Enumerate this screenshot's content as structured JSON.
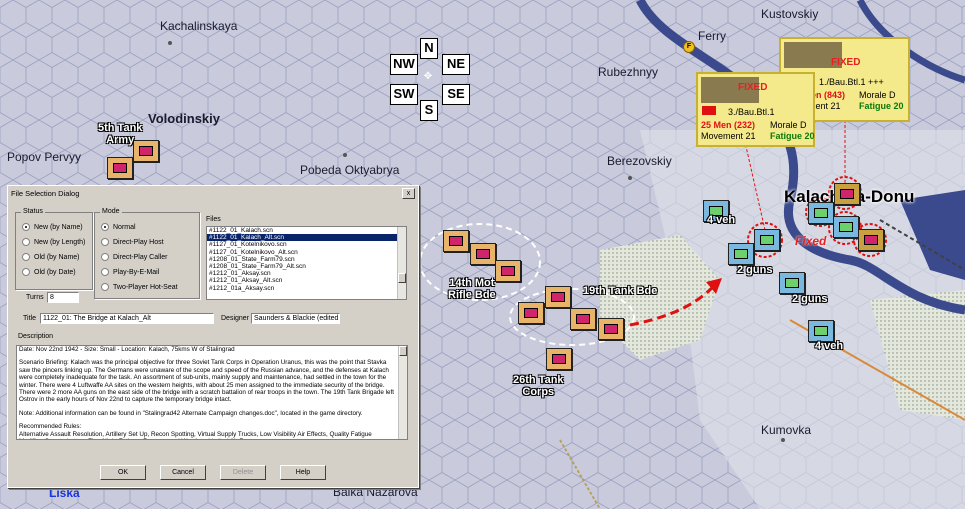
{
  "map": {
    "places": {
      "kachalinskaya": "Kachalinskaya",
      "volodinskiy": "Volodinskiy",
      "popov_pervyy": "Popov Pervyy",
      "pobeda_oktyabrya": "Pobeda Oktyabrya",
      "ferry": "Ferry",
      "kustovskiy": "Kustovskiy",
      "rubezhnyy": "Rubezhnyy",
      "berezovskiy": "Berezovskiy",
      "kalach": "Kalach-na-Donu",
      "kumovka": "Kumovka",
      "liska": "Liska",
      "balka_nazarova": "Balka Nazarova"
    },
    "unit_labels": {
      "army_5th_tank": "5th Tank\nArmy",
      "bde_14th_mot": "14th Mot\nRifle Bde",
      "bde_19th_tank": "19th Tank Bde",
      "corps_26th_tank": "26th Tank\nCorps",
      "veh_4_top": "4 veh",
      "guns_2_a": "2 guns",
      "guns_2_b": "2 guns",
      "veh_4_bottom": "4 veh",
      "fixed": "Fixed"
    },
    "compass": {
      "n": "N",
      "ne": "NE",
      "nw": "NW",
      "se": "SE",
      "sw": "SW",
      "s": "S"
    },
    "ferry_marker": "F",
    "info_card_1": {
      "fixed": "FIXED",
      "unit": "1./Bau.Btl.1 +++",
      "men": "201 Men (843)",
      "morale": "Morale D",
      "movement": "Movement 21",
      "fatigue": "Fatigue 20"
    },
    "info_card_2": {
      "fixed": "FIXED",
      "unit": "3./Bau.Btl.1",
      "men": "25 Men (232)",
      "morale": "Morale D",
      "movement": "Movement 21",
      "fatigue": "Fatigue 20"
    }
  },
  "dialog": {
    "title": "File Selection Dialog",
    "close": "x",
    "status": {
      "label": "Status",
      "options": [
        "New (by Name)",
        "New (by Length)",
        "Old (by Name)",
        "Old (by Date)"
      ],
      "selected": 0
    },
    "mode": {
      "label": "Mode",
      "options": [
        "Normal",
        "Direct-Play Host",
        "Direct-Play Caller",
        "Play-By-E-Mail",
        "Two-Player Hot-Seat"
      ],
      "selected": 0
    },
    "files": {
      "label": "Files",
      "items": [
        "#1122_01_Kalach.scn",
        "#1122_01_Kalach_Alt.scn",
        "#1127_01_Kotelnikovo.scn",
        "#1127_01_Kotelnikovo_Alt.scn",
        "#1208_01_State_Farm79.scn",
        "#1208_01_State_Farm79_Alt.scn",
        "#1212_01_Aksay.scn",
        "#1212_01_Aksay_Alt.scn",
        "#1212_01a_Aksay.scn"
      ],
      "selected": 1
    },
    "turns_label": "Turns",
    "turns_value": "8",
    "title_label": "Title",
    "title_value": "1122_01: The Bridge at Kalach_Alt",
    "designer_label": "Designer",
    "designer_value": "Saunders & Blackie (edited: W",
    "description_label": "Description",
    "description": [
      "Date: Nov 22nd 1942  -  Size: Small  -  Location: Kalach, 75kms W of Stalingrad",
      "Scenario Briefing: Kalach was the principal objective for three Soviet Tank Corps in Operation Uranus, this was the point that Stavka saw the pincers linking up. The Germans were unaware of the scope and speed of the Russian advance, and the defenses at Kalach were completely inadequate for the task. An assortment of sub-units, mainly supply and maintenance, had settled in the town for the winter. There were 4 Luftwaffe AA sites on the western heights, with about 25 men assigned to the immediate security of the bridge. There were 2 more AA guns on the east side of the bridge with a scratch battalion of rear troops in the town. The 19th Tank Brigade left Ostrov in the early hours of Nov 22nd to capture the temporary bridge intact.",
      "Note: Additional information can be found in \"Stalingrad42 Alternate Campaign changes.doc\", located in the game directory.",
      "Recommended Rules:\nAlternative Assault Resolution, Artillery Set Up, Recon Spotting, Virtual Supply Trucks, Low Visibility Air Effects, Quality Fatigue Modifier, Counterbattery Fire, Night Fatigue, Programmed Weather, Limited Air Recon."
    ],
    "buttons": {
      "ok": "OK",
      "cancel": "Cancel",
      "delete": "Delete",
      "help": "Help"
    }
  },
  "colors": {
    "background_hex": "#c9cbdc",
    "river": "#3a4a8c",
    "forest": "#d8ddd0",
    "soviet_unit": "#e8b46a",
    "german_unit": "#7ab8e0",
    "info_card": "#f4ea8c",
    "dialog_face": "#d4d0c8",
    "selection": "#0a246a",
    "fixed_text": "#e82020"
  }
}
